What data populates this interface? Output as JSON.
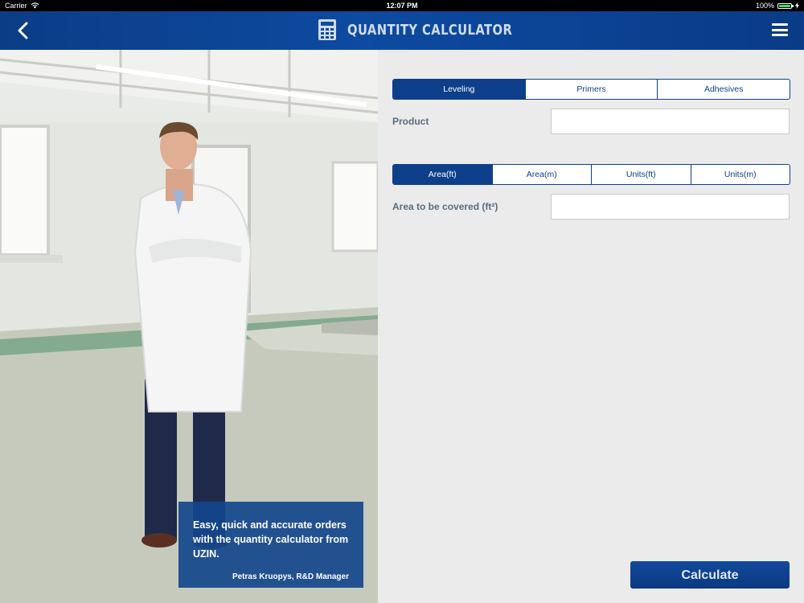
{
  "status_bar": {
    "carrier": "Carrier",
    "time": "12:07 PM",
    "battery": "100%",
    "battery_level": 1.0
  },
  "navbar": {
    "title": "QUANTITY CALCULATOR",
    "back_icon": "chevron-left-icon",
    "title_icon": "calculator-icon",
    "menu_icon": "hamburger-menu-icon",
    "background": "#0d4aa0"
  },
  "photo_panel": {
    "quote": "Easy, quick and accurate orders with the quantity calculator from UZIN.",
    "author": "Petras Kruopys, R&D Manager"
  },
  "form": {
    "product_tabs": [
      {
        "label": "Leveling",
        "active": true
      },
      {
        "label": "Primers",
        "active": false
      },
      {
        "label": "Adhesives",
        "active": false
      }
    ],
    "product_label": "Product",
    "product_value": "",
    "unit_tabs": [
      {
        "label": "Area(ft)",
        "active": true
      },
      {
        "label": "Area(m)",
        "active": false
      },
      {
        "label": "Units(ft)",
        "active": false
      },
      {
        "label": "Units(m)",
        "active": false
      }
    ],
    "area_label": "Area to be covered (ft²)",
    "area_value": "",
    "calculate_label": "Calculate"
  },
  "colors": {
    "accent": "#0d3f8a",
    "panel_bg": "#ebebeb",
    "quote_bg": "#14468c"
  }
}
